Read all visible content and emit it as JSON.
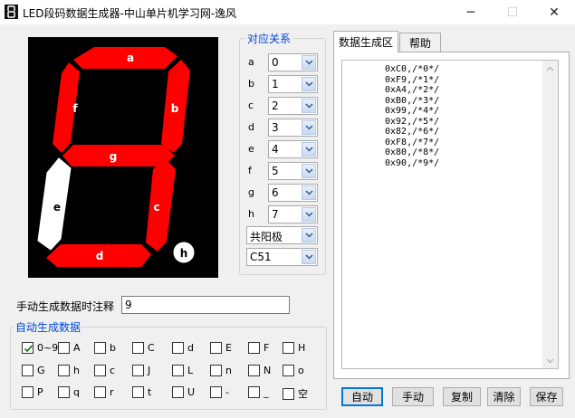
{
  "window": {
    "title": "LED段码数据生成器-中山单片机学习网-逸风",
    "minimize_glyph": "─",
    "maximize_glyph": "☐",
    "close_glyph": "✕"
  },
  "segment_display": {
    "labels": {
      "a": "a",
      "b": "b",
      "c": "c",
      "d": "d",
      "e": "e",
      "f": "f",
      "g": "g",
      "h": "h"
    },
    "segment_states": {
      "a": "on",
      "b": "on",
      "c": "on",
      "d": "on",
      "e": "off",
      "f": "on",
      "g": "on",
      "h": "off"
    },
    "colors": {
      "on": "#ff0000",
      "off": "#ffffff",
      "background": "#000000"
    }
  },
  "mapping": {
    "group_title": "对应关系",
    "rows": [
      {
        "label": "a",
        "value": "0"
      },
      {
        "label": "b",
        "value": "1"
      },
      {
        "label": "c",
        "value": "2"
      },
      {
        "label": "d",
        "value": "3"
      },
      {
        "label": "e",
        "value": "4"
      },
      {
        "label": "f",
        "value": "5"
      },
      {
        "label": "g",
        "value": "6"
      },
      {
        "label": "h",
        "value": "7"
      }
    ],
    "polarity": "共阳极",
    "language": "C51"
  },
  "tabs": [
    {
      "label": "数据生成区",
      "active": true
    },
    {
      "label": "帮助",
      "active": false
    }
  ],
  "output": {
    "lines": [
      "0xC0,/*0*/",
      "0xF9,/*1*/",
      "0xA4,/*2*/",
      "0xB0,/*3*/",
      "0x99,/*4*/",
      "0x92,/*5*/",
      "0x82,/*6*/",
      "0xF8,/*7*/",
      "0x80,/*8*/",
      "0x90,/*9*/"
    ]
  },
  "manual": {
    "label": "手动生成数据时注释",
    "value": "9"
  },
  "auto": {
    "group_title": "自动生成数据",
    "items": [
      {
        "label": "0~9",
        "checked": true
      },
      {
        "label": "A",
        "checked": false
      },
      {
        "label": "b",
        "checked": false
      },
      {
        "label": "C",
        "checked": false
      },
      {
        "label": "d",
        "checked": false
      },
      {
        "label": "E",
        "checked": false
      },
      {
        "label": "F",
        "checked": false
      },
      {
        "label": "H",
        "checked": false
      },
      {
        "label": "G",
        "checked": false
      },
      {
        "label": "h",
        "checked": false
      },
      {
        "label": "c",
        "checked": false
      },
      {
        "label": "J",
        "checked": false
      },
      {
        "label": "L",
        "checked": false
      },
      {
        "label": "n",
        "checked": false
      },
      {
        "label": "N",
        "checked": false
      },
      {
        "label": "o",
        "checked": false
      },
      {
        "label": "P",
        "checked": false
      },
      {
        "label": "q",
        "checked": false
      },
      {
        "label": "r",
        "checked": false
      },
      {
        "label": "t",
        "checked": false
      },
      {
        "label": "U",
        "checked": false
      },
      {
        "label": "-",
        "checked": false
      },
      {
        "label": "_",
        "checked": false
      },
      {
        "label": "空",
        "checked": false
      }
    ]
  },
  "buttons": {
    "auto": "自动",
    "manual": "手动",
    "copy": "复制",
    "clear": "清除",
    "save": "保存"
  }
}
